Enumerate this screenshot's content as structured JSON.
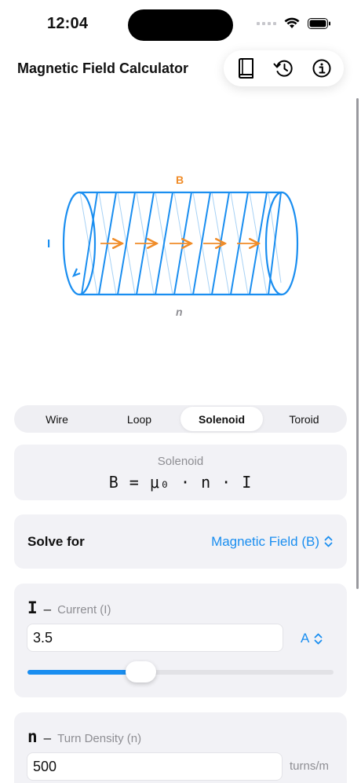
{
  "status": {
    "time": "12:04"
  },
  "header": {
    "title": "Magnetic Field Calculator"
  },
  "toolbar": {
    "icons": [
      "book-icon",
      "history-icon",
      "info-icon"
    ]
  },
  "diagram": {
    "label_B": "B",
    "label_I": "I",
    "label_n": "n"
  },
  "tabs": [
    "Wire",
    "Loop",
    "Solenoid",
    "Toroid"
  ],
  "active_tab": "Solenoid",
  "formula": {
    "name": "Solenoid",
    "expression": "B = μ₀ · n · I"
  },
  "solve": {
    "label": "Solve for",
    "value": "Magnetic Field (B)"
  },
  "current": {
    "symbol": "I",
    "dash": "–",
    "description": "Current (I)",
    "value": "3.5",
    "unit": "A",
    "slider_fraction": 0.37
  },
  "density": {
    "symbol": "n",
    "dash": "–",
    "description": "Turn Density (n)",
    "value": "500",
    "unit": "turns/m"
  },
  "colors": {
    "accent": "#1a8ef0",
    "field": "#f08c28",
    "card": "#f2f2f6"
  }
}
